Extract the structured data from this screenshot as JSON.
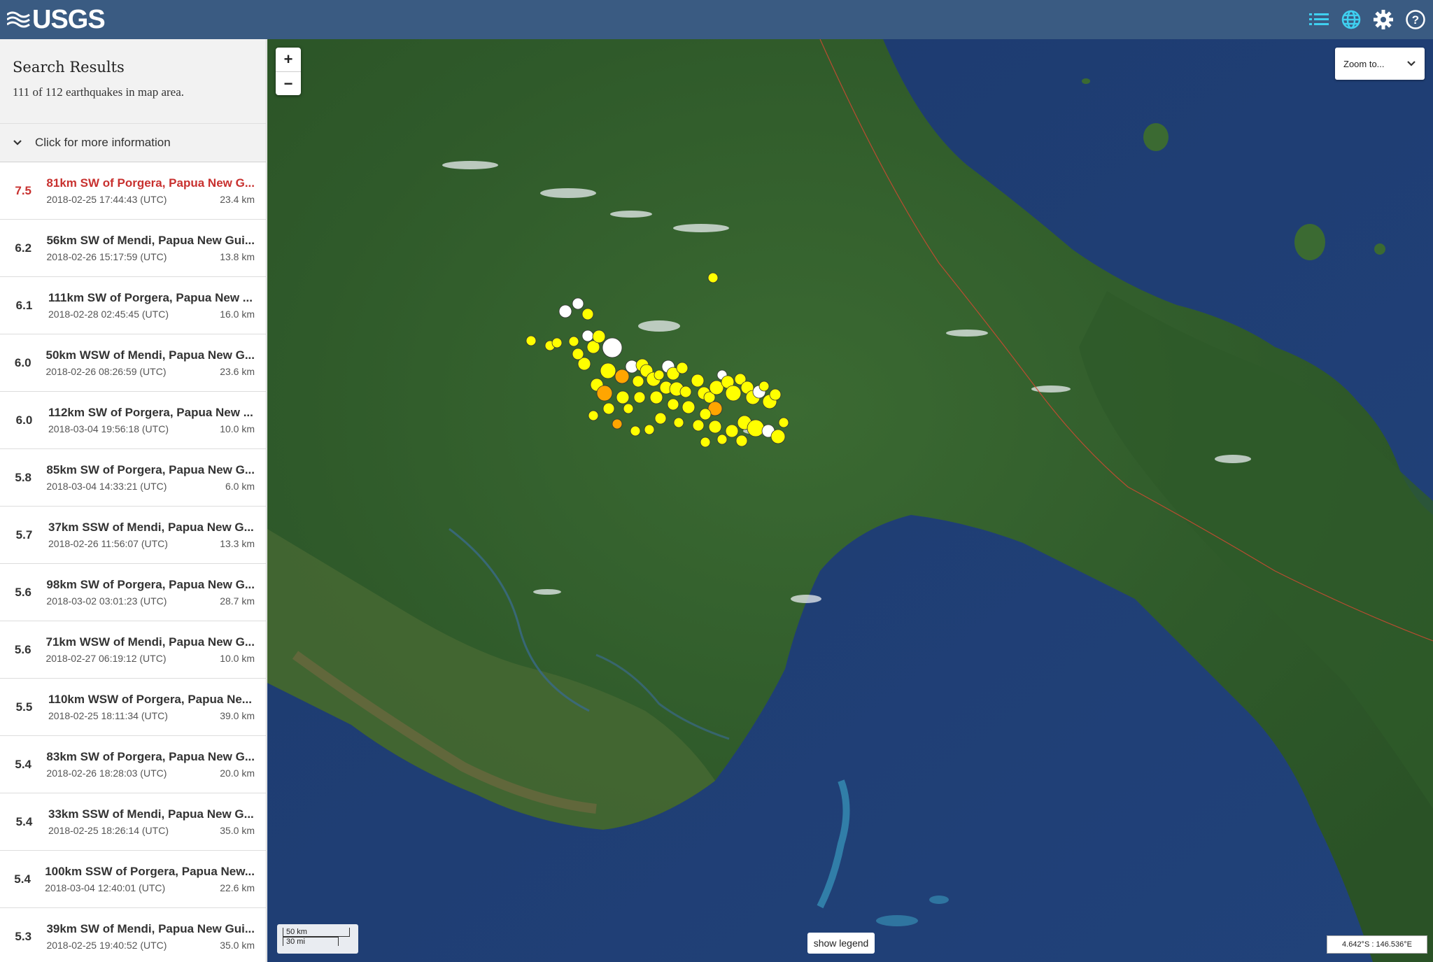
{
  "header": {
    "logo_text": "USGS",
    "icons": [
      "list-icon",
      "globe-icon",
      "gear-icon",
      "help-icon"
    ],
    "accent_color": "#3a5b82",
    "icon_color": "#3fd0f0"
  },
  "sidebar": {
    "title": "Search Results",
    "count_text": "111 of 112 earthquakes in map area.",
    "more_info_label": "Click for more information",
    "earthquakes": [
      {
        "mag": "7.5",
        "place": "81km SW of Porgera, Papua New G...",
        "time": "2018-02-25 17:44:43 (UTC)",
        "depth": "23.4 km",
        "major": true
      },
      {
        "mag": "6.2",
        "place": "56km SW of Mendi, Papua New Gui...",
        "time": "2018-02-26 15:17:59 (UTC)",
        "depth": "13.8 km"
      },
      {
        "mag": "6.1",
        "place": "111km SW of Porgera, Papua New ...",
        "time": "2018-02-28 02:45:45 (UTC)",
        "depth": "16.0 km"
      },
      {
        "mag": "6.0",
        "place": "50km WSW of Mendi, Papua New G...",
        "time": "2018-02-26 08:26:59 (UTC)",
        "depth": "23.6 km"
      },
      {
        "mag": "6.0",
        "place": "112km SW of Porgera, Papua New ...",
        "time": "2018-03-04 19:56:18 (UTC)",
        "depth": "10.0 km"
      },
      {
        "mag": "5.8",
        "place": "85km SW of Porgera, Papua New G...",
        "time": "2018-03-04 14:33:21 (UTC)",
        "depth": "6.0 km"
      },
      {
        "mag": "5.7",
        "place": "37km SSW of Mendi, Papua New G...",
        "time": "2018-02-26 11:56:07 (UTC)",
        "depth": "13.3 km"
      },
      {
        "mag": "5.6",
        "place": "98km SW of Porgera, Papua New G...",
        "time": "2018-03-02 03:01:23 (UTC)",
        "depth": "28.7 km"
      },
      {
        "mag": "5.6",
        "place": "71km WSW of Mendi, Papua New G...",
        "time": "2018-02-27 06:19:12 (UTC)",
        "depth": "10.0 km"
      },
      {
        "mag": "5.5",
        "place": "110km WSW of Porgera, Papua Ne...",
        "time": "2018-02-25 18:11:34 (UTC)",
        "depth": "39.0 km"
      },
      {
        "mag": "5.4",
        "place": "83km SW of Porgera, Papua New G...",
        "time": "2018-02-26 18:28:03 (UTC)",
        "depth": "20.0 km"
      },
      {
        "mag": "5.4",
        "place": "33km SSW of Mendi, Papua New G...",
        "time": "2018-02-25 18:26:14 (UTC)",
        "depth": "35.0 km"
      },
      {
        "mag": "5.4",
        "place": "100km SSW of Porgera, Papua New...",
        "time": "2018-03-04 12:40:01 (UTC)",
        "depth": "22.6 km"
      },
      {
        "mag": "5.3",
        "place": "39km SW of Mendi, Papua New Gui...",
        "time": "2018-02-25 19:40:52 (UTC)",
        "depth": "35.0 km"
      }
    ],
    "major_color": "#c8312f"
  },
  "map": {
    "zoom_in": "+",
    "zoom_out": "−",
    "zoom_to_label": "Zoom to...",
    "scale_km": "50 km",
    "scale_mi": "30 mi",
    "legend_button": "show legend",
    "coordinates": "4.642°S : 146.536°E",
    "marker_colors": {
      "recent_hour": "#ffffff",
      "past_day": "#ffa500",
      "past_week": "#ffff00"
    }
  }
}
